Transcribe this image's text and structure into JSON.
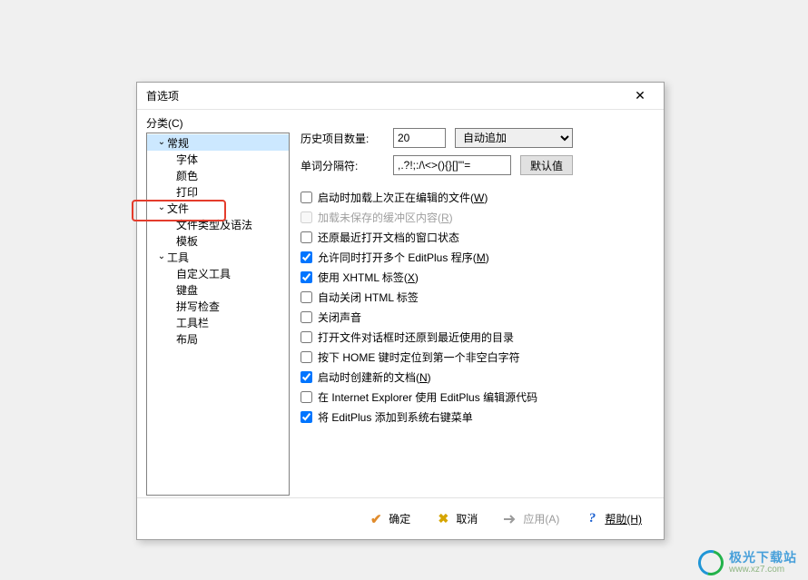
{
  "dialog": {
    "title": "首选项",
    "close_glyph": "✕"
  },
  "category_label": "分类(C)",
  "tree": {
    "general": "常规",
    "font": "字体",
    "color": "颜色",
    "print": "打印",
    "file": "文件",
    "filetypes": "文件类型及语法",
    "templates": "模板",
    "tools": "工具",
    "custom_tools": "自定义工具",
    "keyboard": "键盘",
    "spell": "拼写检查",
    "toolbar": "工具栏",
    "layout": "布局"
  },
  "form": {
    "history_label": "历史项目数量:",
    "history_value": "20",
    "auto_append": "自动追加",
    "word_sep_label": "单词分隔符:",
    "word_sep_value": ",.?!;:/\\<>(){}[]\"'=",
    "default_btn": "默认值"
  },
  "checks": [
    {
      "key": "load_last",
      "label": "启动时加载上次正在编辑的文件(",
      "u": "W",
      "suffix": ")",
      "checked": false,
      "disabled": false
    },
    {
      "key": "load_unsaved",
      "label": "加载未保存的缓冲区内容(",
      "u": "R",
      "suffix": ")",
      "checked": false,
      "disabled": true
    },
    {
      "key": "restore_state",
      "label": "还原最近打开文档的窗口状态",
      "checked": false
    },
    {
      "key": "multi_instance",
      "label": "允许同时打开多个 EditPlus 程序(",
      "u": "M",
      "suffix": ")",
      "checked": true
    },
    {
      "key": "xhtml",
      "label": "使用 XHTML 标签(",
      "u": "X",
      "suffix": ")",
      "checked": true
    },
    {
      "key": "auto_close_html",
      "label": "自动关闭 HTML 标签",
      "checked": false
    },
    {
      "key": "mute",
      "label": "关闭声音",
      "checked": false
    },
    {
      "key": "restore_dir",
      "label": "打开文件对话框时还原到最近使用的目录",
      "checked": false
    },
    {
      "key": "home_nonblank",
      "label": "按下 HOME 键时定位到第一个非空白字符",
      "checked": false
    },
    {
      "key": "new_doc",
      "label": "启动时创建新的文档(",
      "u": "N",
      "suffix": ")",
      "checked": true
    },
    {
      "key": "ie_source",
      "label": "在 Internet Explorer 使用 EditPlus 编辑源代码",
      "checked": false
    },
    {
      "key": "context_menu",
      "label": "将 EditPlus 添加到系统右键菜单",
      "checked": true
    }
  ],
  "buttons": {
    "ok": "确定",
    "cancel": "取消",
    "apply": "应用(A)",
    "help": "帮助(H)"
  },
  "watermark": {
    "cn": "极光下载站",
    "url": "www.xz7.com"
  }
}
